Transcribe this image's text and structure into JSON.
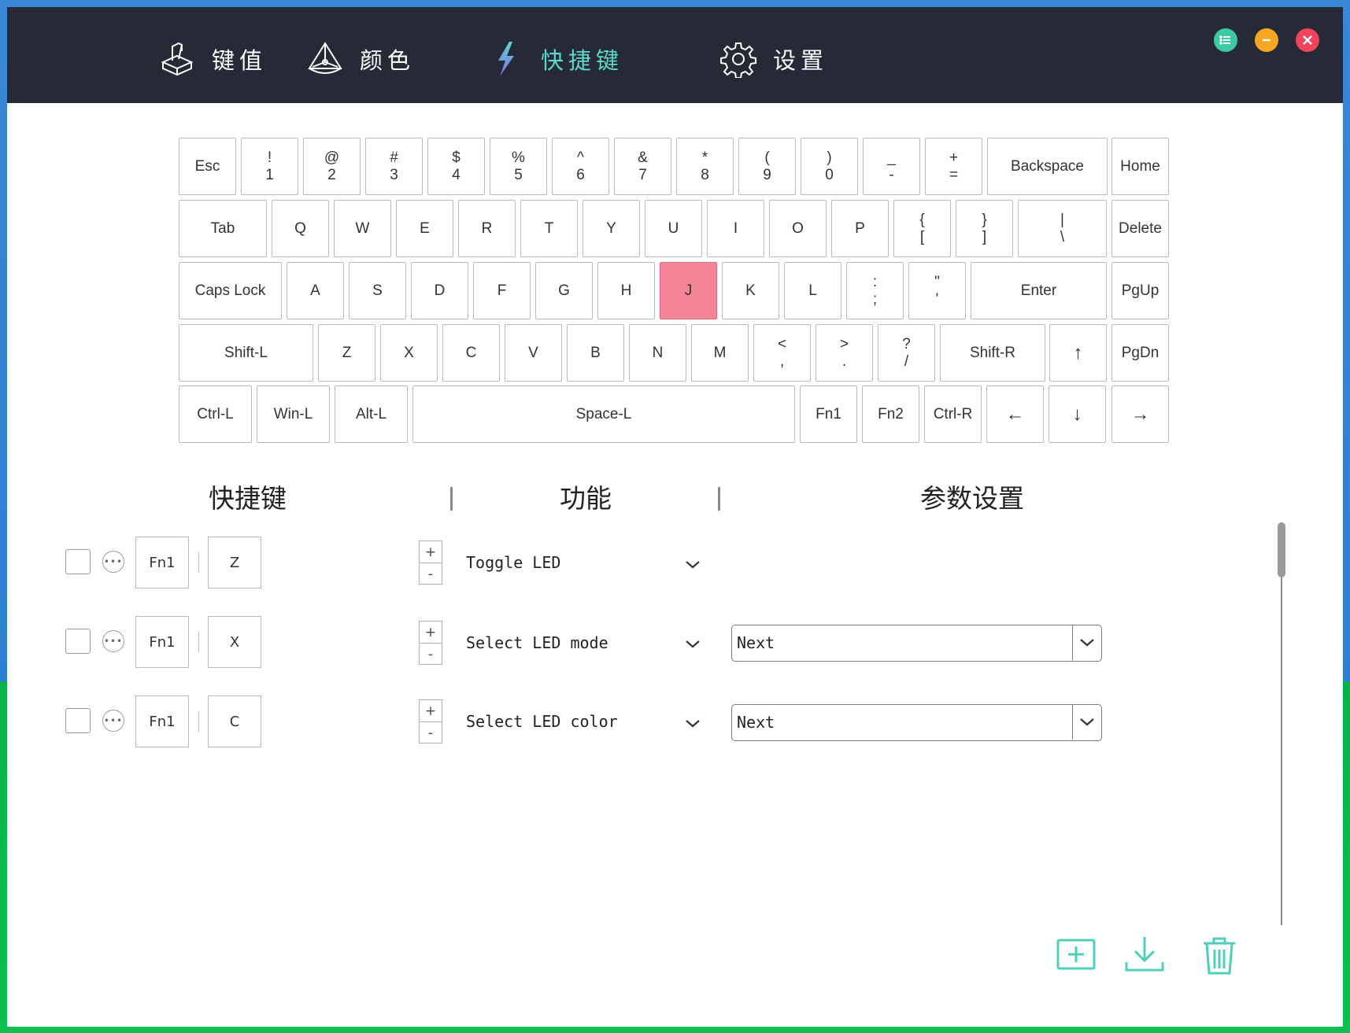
{
  "nav": [
    {
      "label": "键值",
      "icon": "keycap-icon",
      "active": false
    },
    {
      "label": "颜色",
      "icon": "prism-color-icon",
      "active": false
    },
    {
      "label": "快捷键",
      "icon": "lightning-icon",
      "active": true
    },
    {
      "label": "设置",
      "icon": "gear-icon",
      "active": false
    }
  ],
  "window_controls": {
    "menu": "list-icon",
    "minimize": "minus-icon",
    "close": "close-icon"
  },
  "colors": {
    "accent": "#5fd8c9",
    "topbar": "#262a37",
    "selected_key": "#f48597",
    "menu_btn": "#3dc9a2",
    "min_btn": "#f5a623",
    "close_btn": "#f0445a"
  },
  "keyboard": {
    "selected": "J",
    "rows": [
      [
        {
          "t": "",
          "b": "Esc"
        },
        {
          "t": "!",
          "b": "1"
        },
        {
          "t": "@",
          "b": "2"
        },
        {
          "t": "#",
          "b": "3"
        },
        {
          "t": "$",
          "b": "4"
        },
        {
          "t": "%",
          "b": "5"
        },
        {
          "t": "^",
          "b": "6"
        },
        {
          "t": "&",
          "b": "7"
        },
        {
          "t": "*",
          "b": "8"
        },
        {
          "t": "(",
          "b": "9"
        },
        {
          "t": ")",
          "b": "0"
        },
        {
          "t": "_",
          "b": "-"
        },
        {
          "t": "+",
          "b": "="
        },
        {
          "t": "",
          "b": "Backspace"
        },
        {
          "t": "",
          "b": "Home"
        }
      ],
      [
        {
          "t": "",
          "b": "Tab"
        },
        {
          "t": "",
          "b": "Q"
        },
        {
          "t": "",
          "b": "W"
        },
        {
          "t": "",
          "b": "E"
        },
        {
          "t": "",
          "b": "R"
        },
        {
          "t": "",
          "b": "T"
        },
        {
          "t": "",
          "b": "Y"
        },
        {
          "t": "",
          "b": "U"
        },
        {
          "t": "",
          "b": "I"
        },
        {
          "t": "",
          "b": "O"
        },
        {
          "t": "",
          "b": "P"
        },
        {
          "t": "{",
          "b": "["
        },
        {
          "t": "}",
          "b": "]"
        },
        {
          "t": "|",
          "b": "\\"
        },
        {
          "t": "",
          "b": "Delete"
        }
      ],
      [
        {
          "t": "",
          "b": "Caps Lock"
        },
        {
          "t": "",
          "b": "A"
        },
        {
          "t": "",
          "b": "S"
        },
        {
          "t": "",
          "b": "D"
        },
        {
          "t": "",
          "b": "F"
        },
        {
          "t": "",
          "b": "G"
        },
        {
          "t": "",
          "b": "H"
        },
        {
          "t": "",
          "b": "J"
        },
        {
          "t": "",
          "b": "K"
        },
        {
          "t": "",
          "b": "L"
        },
        {
          "t": ":",
          "b": ";"
        },
        {
          "t": "\"",
          "b": "'"
        },
        {
          "t": "",
          "b": "Enter"
        },
        {
          "t": "",
          "b": "PgUp"
        }
      ],
      [
        {
          "t": "",
          "b": "Shift-L"
        },
        {
          "t": "",
          "b": "Z"
        },
        {
          "t": "",
          "b": "X"
        },
        {
          "t": "",
          "b": "C"
        },
        {
          "t": "",
          "b": "V"
        },
        {
          "t": "",
          "b": "B"
        },
        {
          "t": "",
          "b": "N"
        },
        {
          "t": "",
          "b": "M"
        },
        {
          "t": "<",
          "b": ","
        },
        {
          "t": ">",
          "b": "."
        },
        {
          "t": "?",
          "b": "/"
        },
        {
          "t": "",
          "b": "Shift-R"
        },
        {
          "t": "",
          "b": "↑"
        },
        {
          "t": "",
          "b": "PgDn"
        }
      ],
      [
        {
          "t": "",
          "b": "Ctrl-L"
        },
        {
          "t": "",
          "b": "Win-L"
        },
        {
          "t": "",
          "b": "Alt-L"
        },
        {
          "t": "",
          "b": "Space-L"
        },
        {
          "t": "",
          "b": "Fn1"
        },
        {
          "t": "",
          "b": "Fn2"
        },
        {
          "t": "",
          "b": "Ctrl-R"
        },
        {
          "t": "",
          "b": "←"
        },
        {
          "t": "",
          "b": "↓"
        },
        {
          "t": "",
          "b": "→"
        }
      ]
    ]
  },
  "table": {
    "headers": {
      "shortcut": "快捷键",
      "function": "功能",
      "params": "参数设置"
    },
    "rows": [
      {
        "keys": [
          "Fn1",
          "Z"
        ],
        "function": "Toggle LED",
        "param": null
      },
      {
        "keys": [
          "Fn1",
          "X"
        ],
        "function": "Select LED mode",
        "param": "Next"
      },
      {
        "keys": [
          "Fn1",
          "C"
        ],
        "function": "Select LED color",
        "param": "Next"
      }
    ],
    "stepper": {
      "plus": "+",
      "minus": "-"
    },
    "more_glyph": "•••"
  },
  "actions": [
    {
      "name": "add-shortcut-button",
      "icon": "add-box-icon"
    },
    {
      "name": "download-button",
      "icon": "download-icon"
    },
    {
      "name": "delete-button",
      "icon": "trash-icon"
    }
  ]
}
